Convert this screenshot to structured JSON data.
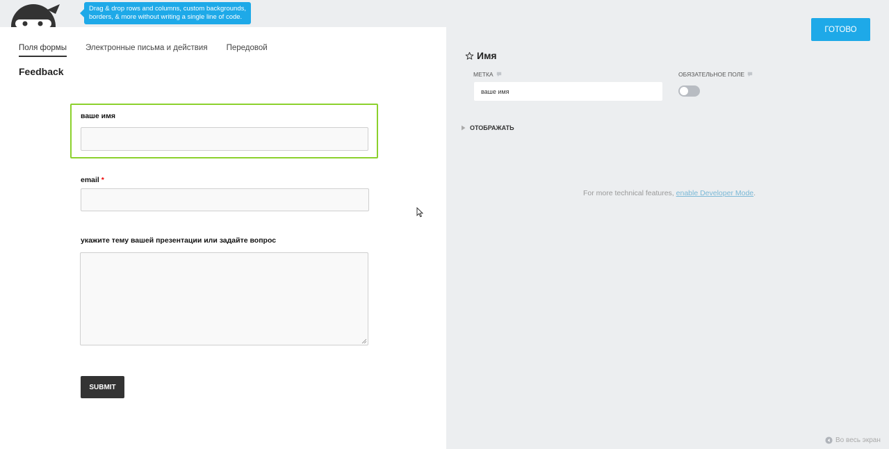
{
  "tooltip": {
    "line1": "Drag & drop rows and columns, custom backgrounds,",
    "line2": "borders, & more without writing a single line of code."
  },
  "tabs": [
    {
      "label": "Поля формы",
      "active": true
    },
    {
      "label": "Электронные письма и действия",
      "active": false
    },
    {
      "label": "Передовой",
      "active": false
    }
  ],
  "form": {
    "title": "Feedback",
    "fields": [
      {
        "label": "ваше имя",
        "required": false,
        "type": "text",
        "value": ""
      },
      {
        "label": "email",
        "required": true,
        "required_mark": "*",
        "type": "text",
        "value": ""
      },
      {
        "label": "укажите тему вашей презентации или задайте вопрос",
        "required": false,
        "type": "textarea",
        "value": ""
      }
    ],
    "submit_label": "SUBMIT"
  },
  "panel": {
    "done_label": "ГОТОВО",
    "title": "Имя",
    "label_heading": "МЕТКА",
    "label_value": "ваше имя",
    "required_heading": "ОБЯЗАТЕЛЬНОЕ ПОЛЕ",
    "required_on": false,
    "display_section": "ОТОБРАЖАТЬ",
    "dev_note_prefix": "For more technical features, ",
    "dev_note_link": "enable Developer Mode",
    "dev_note_suffix": ".",
    "fullscreen_label": "Во весь экран"
  },
  "colors": {
    "accent": "#1ea9e8",
    "selected_border": "#8bd12c",
    "submit_bg": "#333333",
    "panel_bg": "#eceef0",
    "required": "#e00000"
  },
  "icons": {
    "logo": "ninja-logo-icon",
    "title": "star-outline-icon",
    "help": "speech-bubble-icon",
    "expand": "triangle-right-icon",
    "fullscreen": "circle-arrow-left-icon",
    "cursor": "mouse-pointer-icon"
  }
}
